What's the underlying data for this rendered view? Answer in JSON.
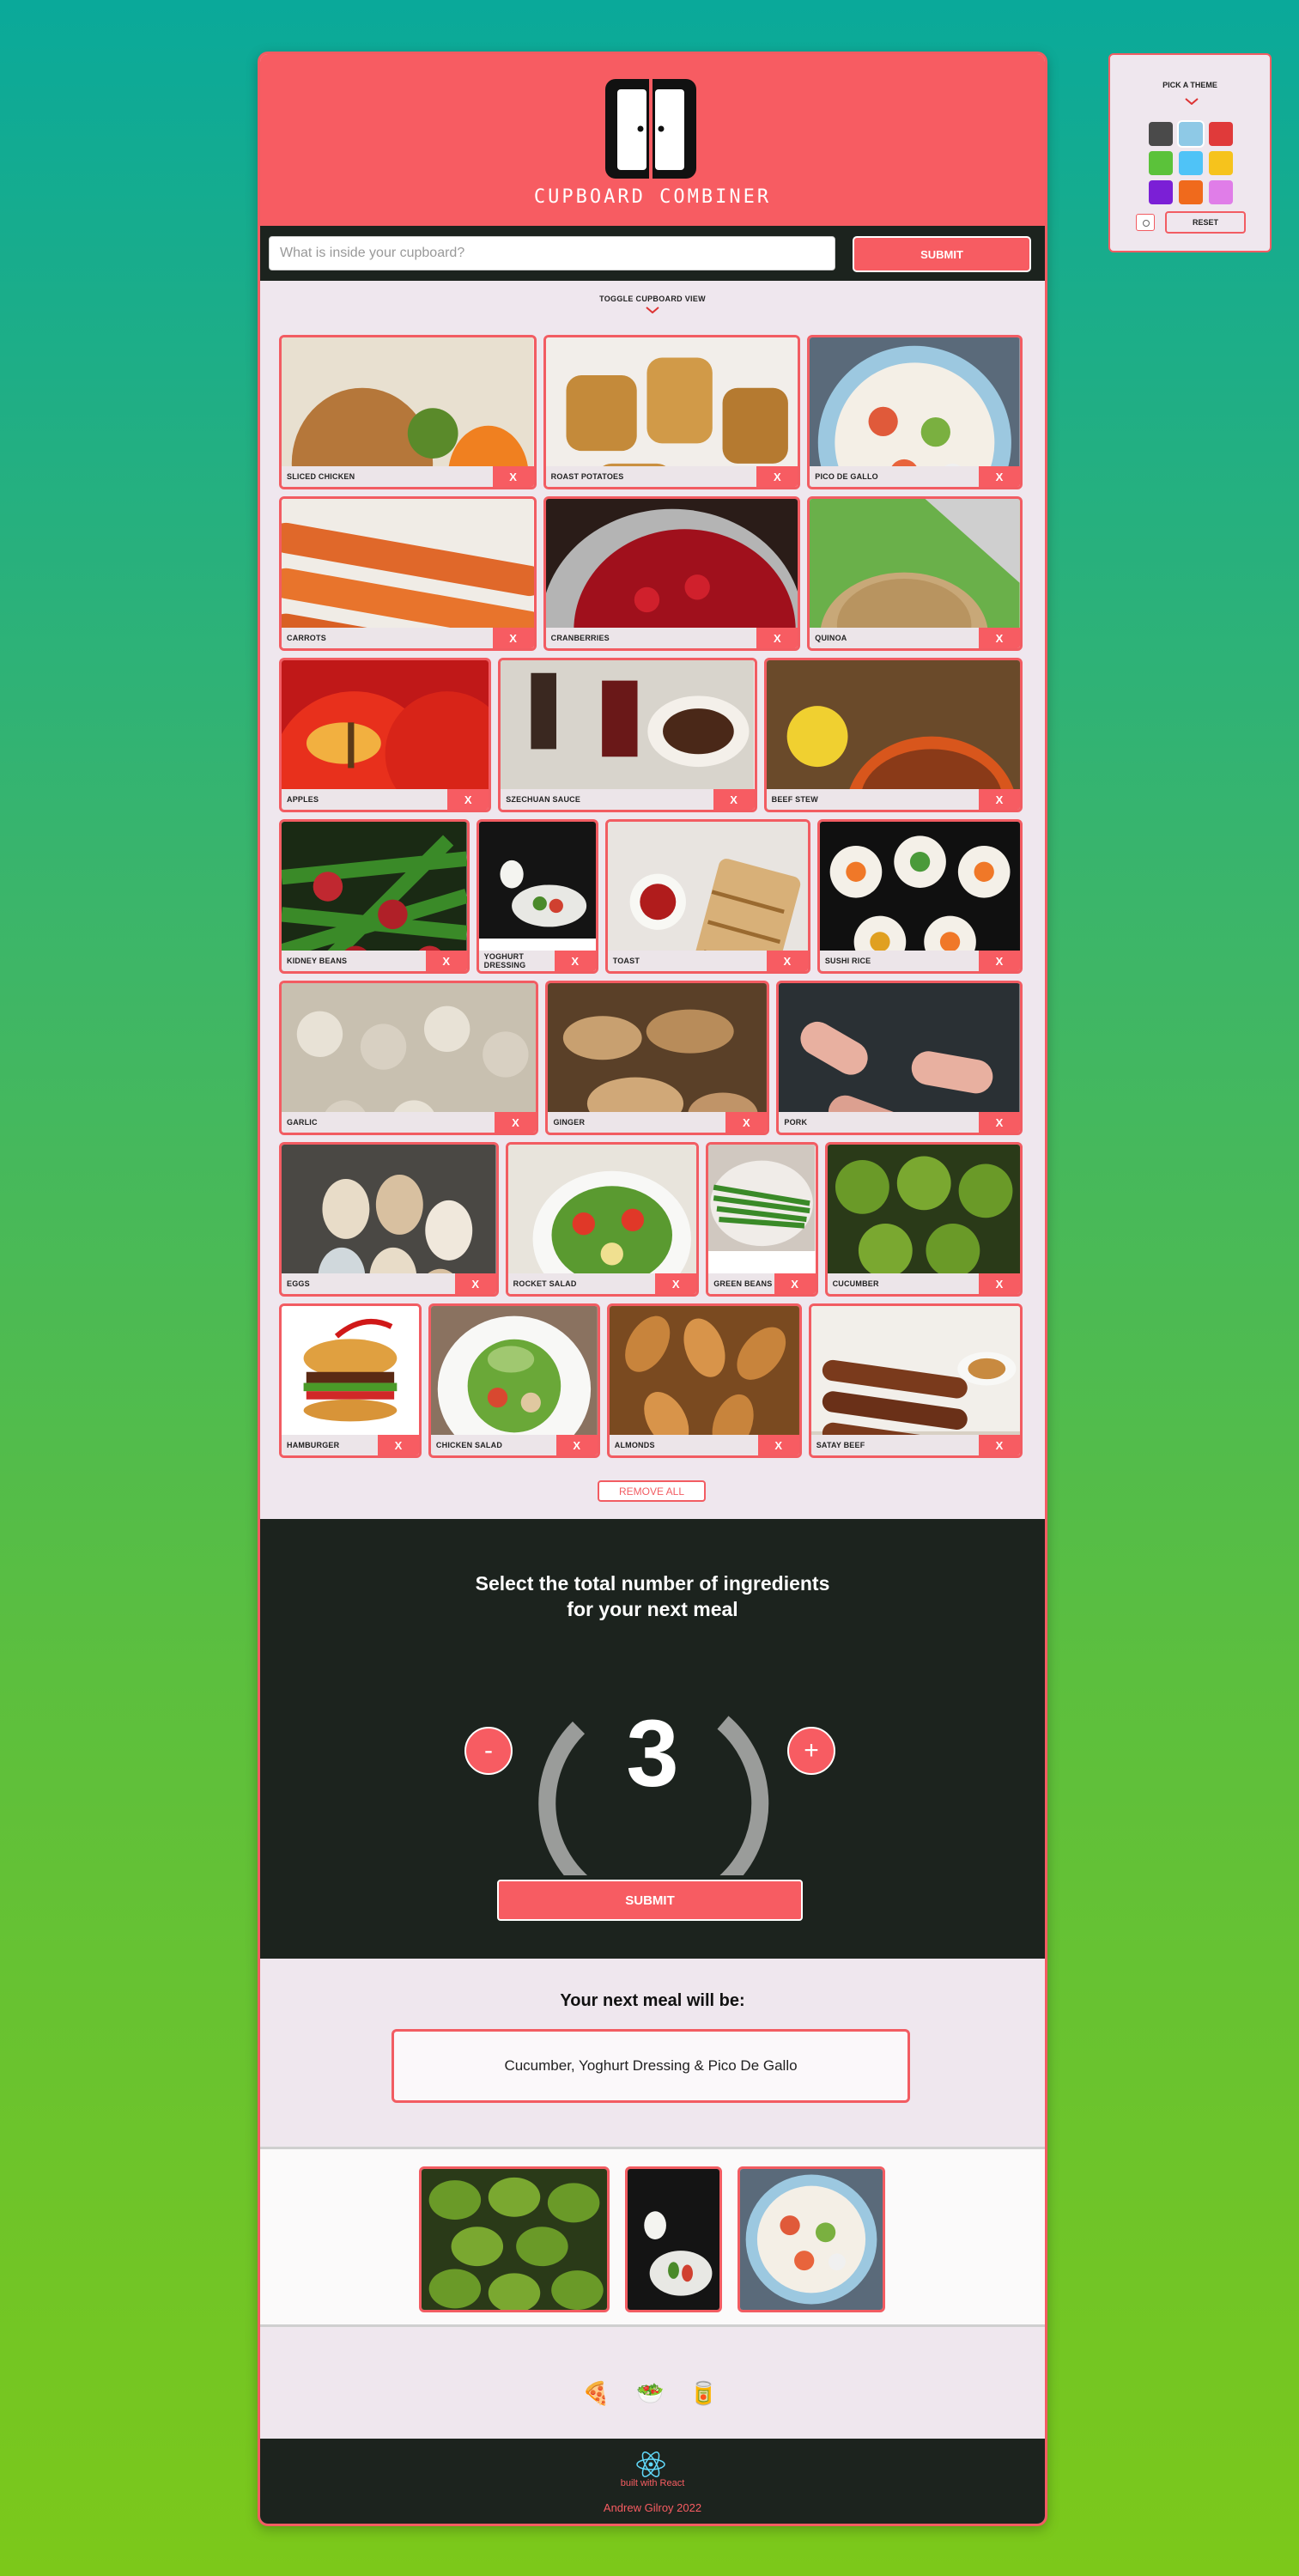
{
  "app": {
    "brand": "CUPBOARD COMBINER"
  },
  "search": {
    "placeholder": "What is inside your cupboard?",
    "submit": "SUBMIT"
  },
  "cupboard": {
    "toggle_label": "TOGGLE CUPBOARD VIEW",
    "remove_label": "X",
    "rows": [
      [
        {
          "label": "SLICED CHICKEN"
        },
        {
          "label": "ROAST POTATOES"
        },
        {
          "label": "PICO DE GALLO"
        }
      ],
      [
        {
          "label": "CARROTS"
        },
        {
          "label": "CRANBERRIES"
        },
        {
          "label": "QUINOA"
        }
      ],
      [
        {
          "label": "APPLES"
        },
        {
          "label": "SZECHUAN SAUCE"
        },
        {
          "label": "BEEF STEW"
        }
      ],
      [
        {
          "label": "KIDNEY BEANS"
        },
        {
          "label": "YOGHURT DRESSING"
        },
        {
          "label": "TOAST"
        },
        {
          "label": "SUSHI RICE"
        }
      ],
      [
        {
          "label": "GARLIC"
        },
        {
          "label": "GINGER"
        },
        {
          "label": "PORK"
        }
      ],
      [
        {
          "label": "EGGS"
        },
        {
          "label": "ROCKET SALAD"
        },
        {
          "label": "GREEN BEANS"
        },
        {
          "label": "CUCUMBER"
        }
      ],
      [
        {
          "label": "HAMBURGER"
        },
        {
          "label": "CHICKEN SALAD"
        },
        {
          "label": "ALMONDS"
        },
        {
          "label": "SATAY BEEF"
        }
      ]
    ],
    "remove_all": "REMOVE ALL"
  },
  "counter": {
    "title_line1": "Select the total number of ingredients",
    "title_line2": "for your next meal",
    "minus": "-",
    "plus": "+",
    "value": "3",
    "submit": "SUBMIT"
  },
  "result": {
    "heading": "Your next meal will be:",
    "meal": "Cucumber, Yoghurt Dressing & Pico De Gallo"
  },
  "footer": {
    "built_with": "built with React",
    "author": "Andrew Gilroy 2022"
  },
  "theme_picker": {
    "title": "PICK A THEME",
    "reset": "RESET",
    "swatches": [
      "#4a4a4a",
      "#8ec9e6",
      "#e03a3a",
      "#5bc23a",
      "#4fc3f7",
      "#f6c31c",
      "#7b1fd6",
      "#f06a1c",
      "#e07de8"
    ]
  }
}
